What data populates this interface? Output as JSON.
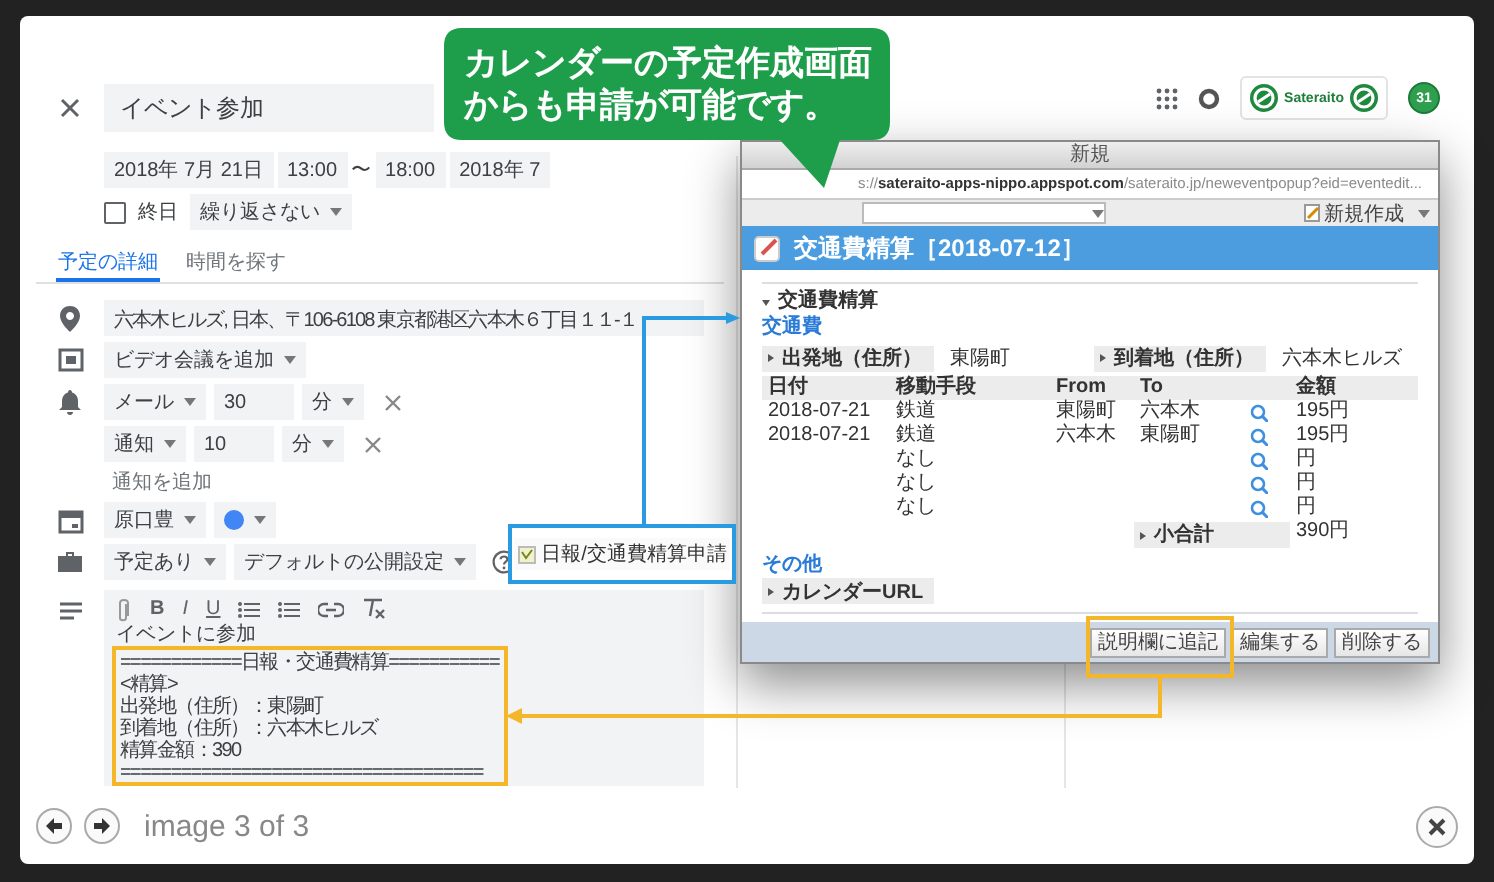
{
  "event_form": {
    "title": "イベント参加",
    "start_date": "2018年 7月 21日",
    "start_time": "13:00",
    "range_separator": "〜",
    "end_time": "18:00",
    "end_date": "2018年 7",
    "all_day": {
      "label": "終日",
      "checked": false
    },
    "repeat": "繰り返さない",
    "tabs": [
      {
        "label": "予定の詳細",
        "selected": true
      },
      {
        "label": "時間を探す",
        "selected": false
      }
    ],
    "location": "六本木ヒルズ, 日本、〒106-6108 東京都港区六本木６丁目１１-１",
    "video_call": "ビデオ会議を追加",
    "notifications": [
      {
        "method": "メール",
        "value": "30",
        "unit": "分"
      },
      {
        "method": "通知",
        "value": "10",
        "unit": "分"
      }
    ],
    "add_notification": "通知を追加",
    "calendar_owner": "原口豊",
    "availability": "予定あり",
    "visibility": "デフォルトの公開設定",
    "format_buttons": [
      "B",
      "I",
      "U"
    ],
    "description_intro": "イベントに参加",
    "description_highlighted": [
      "============日報・交通費精算===========",
      "<精算>",
      "出発地（住所）：東陽町",
      "到着地（住所）：六本木ヒルズ",
      "精算金額：390",
      "===================================="
    ]
  },
  "top_bar": {
    "logo_text": "Sateraito",
    "calendar_badge": "31"
  },
  "addon_button": {
    "label": "日報/交通費精算申請"
  },
  "callout": {
    "text": "カレンダーの予定作成画面からも申請が可能です。"
  },
  "popup": {
    "window_title": "新規",
    "url": "s://**sateraito-apps-nippo.appspot.com**/sateraito.jp/neweventpopup?eid=eventedit...",
    "new_button": "新規作成",
    "heading": "交通費精算［2018-07-12］",
    "section": "交通費精算",
    "subsection": "交通費",
    "origin_label": "出発地（住所）",
    "origin": "東陽町",
    "destination_label": "到着地（住所）",
    "destination": "六本木ヒルズ",
    "columns": [
      "日付",
      "移動手段",
      "From",
      "To",
      "金額"
    ],
    "rows": [
      {
        "date": "2018-07-21",
        "method": "鉄道",
        "from": "東陽町",
        "to": "六本木",
        "amount": "195円"
      },
      {
        "date": "2018-07-21",
        "method": "鉄道",
        "from": "六本木",
        "to": "東陽町",
        "amount": "195円"
      },
      {
        "method": "なし",
        "amount": "円"
      },
      {
        "method": "なし",
        "amount": "円"
      },
      {
        "method": "なし",
        "amount": "円"
      }
    ],
    "subtotal_label": "小合計",
    "subtotal": "390円",
    "other_section": "その他",
    "calendar_url_label": "カレンダーURL",
    "buttons": [
      "説明欄に追記",
      "編集する",
      "削除する"
    ]
  },
  "viewer": {
    "counter": "image 3 of 3"
  }
}
